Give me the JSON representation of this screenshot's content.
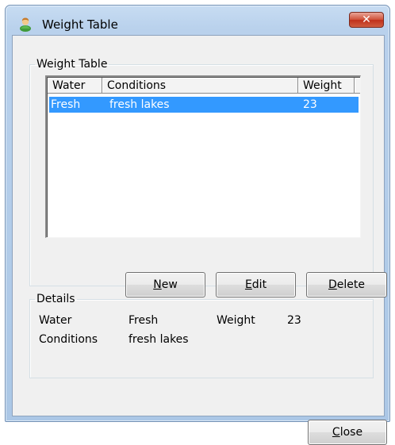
{
  "window": {
    "title": "Weight Table",
    "close_glyph": "✕"
  },
  "groups": {
    "table_legend": "Weight Table",
    "details_legend": "Details"
  },
  "list": {
    "columns": [
      "Water",
      "Conditions",
      "Weight"
    ],
    "rows": [
      {
        "water": "Fresh",
        "conditions": "fresh lakes",
        "weight": "23",
        "selected": true
      }
    ]
  },
  "buttons": {
    "new_mnemonic": "N",
    "new_rest": "ew",
    "edit_mnemonic": "E",
    "edit_rest": "dit",
    "delete_mnemonic": "D",
    "delete_rest": "elete",
    "close_mnemonic": "C",
    "close_rest": "lose"
  },
  "details": {
    "water_label": "Water",
    "water_value": "Fresh",
    "weight_label": "Weight",
    "weight_value": "23",
    "conditions_label": "Conditions",
    "conditions_value": "fresh lakes"
  },
  "colors": {
    "selection": "#3399ff",
    "dialog_background": "#f0f0f0",
    "close_button": "#c7422a"
  },
  "icons": {
    "app": "user-icon",
    "close": "close-icon"
  }
}
